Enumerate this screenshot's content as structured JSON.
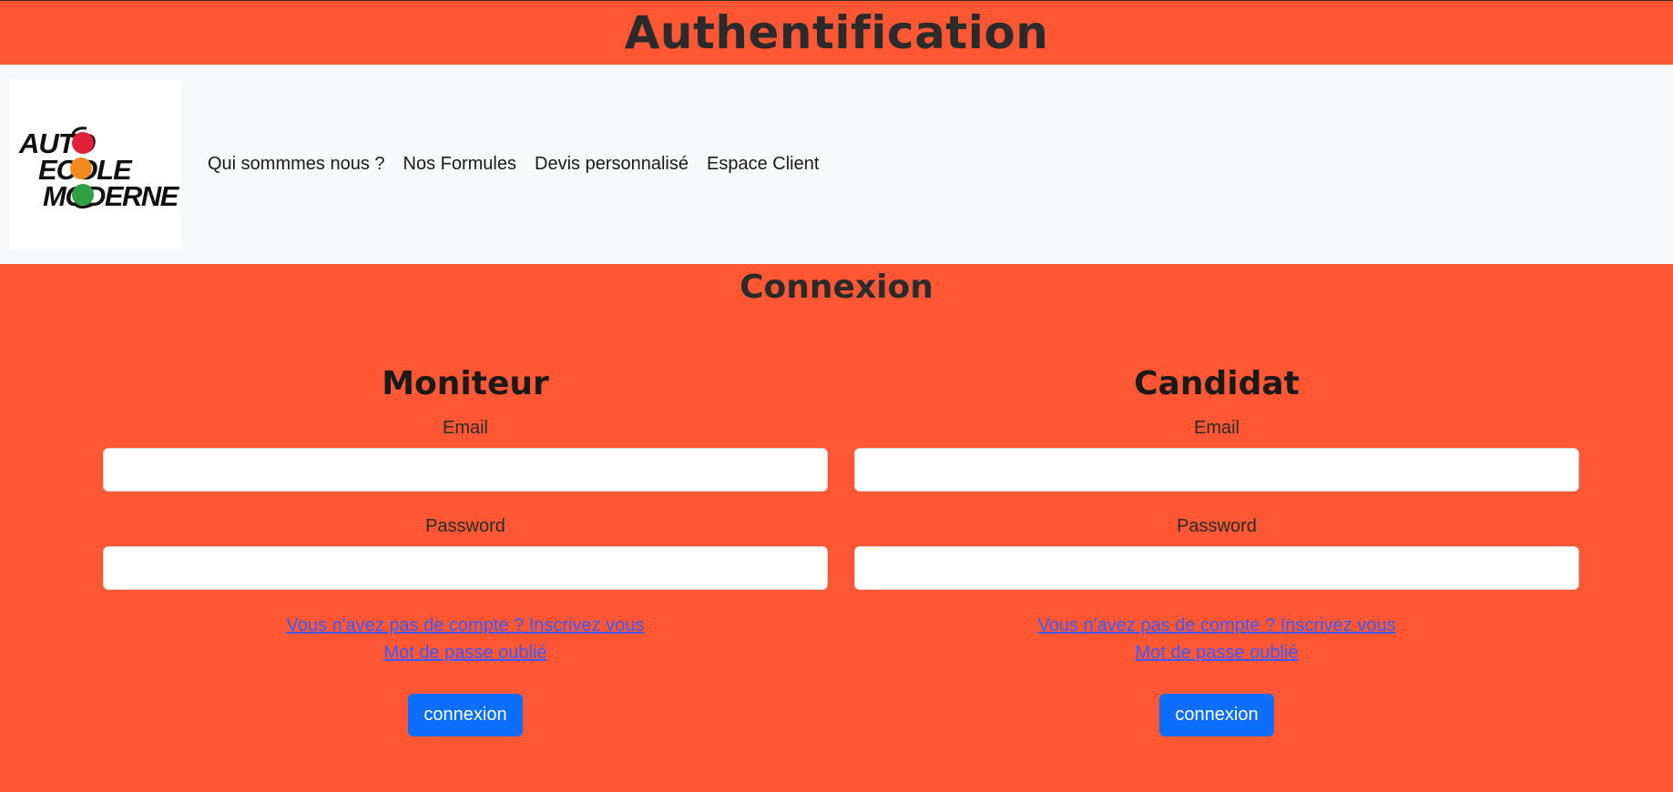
{
  "header": {
    "title": "Authentification"
  },
  "logo": {
    "line1": "AUTO",
    "line2": "ECOLE",
    "line3": "MODERNE",
    "colors": {
      "red": "#e3203a",
      "orange": "#f28a1d",
      "green": "#2ea043"
    }
  },
  "nav": {
    "items": [
      {
        "label": "Qui sommmes nous ?"
      },
      {
        "label": "Nos Formules"
      },
      {
        "label": "Devis personnalisé"
      },
      {
        "label": "Espace Client"
      }
    ]
  },
  "main": {
    "title": "Connexion",
    "forms": [
      {
        "title": "Moniteur",
        "email_label": "Email",
        "email_value": "",
        "password_label": "Password",
        "password_value": "",
        "signup_link": "Vous n'avez pas de compte ? Inscrivez vous",
        "forgot_link": "Mot de passe oublié",
        "submit_label": "connexion"
      },
      {
        "title": "Candidat",
        "email_label": "Email",
        "email_value": "",
        "password_label": "Password",
        "password_value": "",
        "signup_link": "Vous n'avez pas de compte ? Inscrivez vous",
        "forgot_link": "Mot de passe oublié",
        "submit_label": "connexion"
      }
    ]
  },
  "theme": {
    "background": "#ff5733",
    "navbar_bg": "#f8f9fa",
    "button_bg": "#0d6efd",
    "link_color": "#3d5afe"
  }
}
